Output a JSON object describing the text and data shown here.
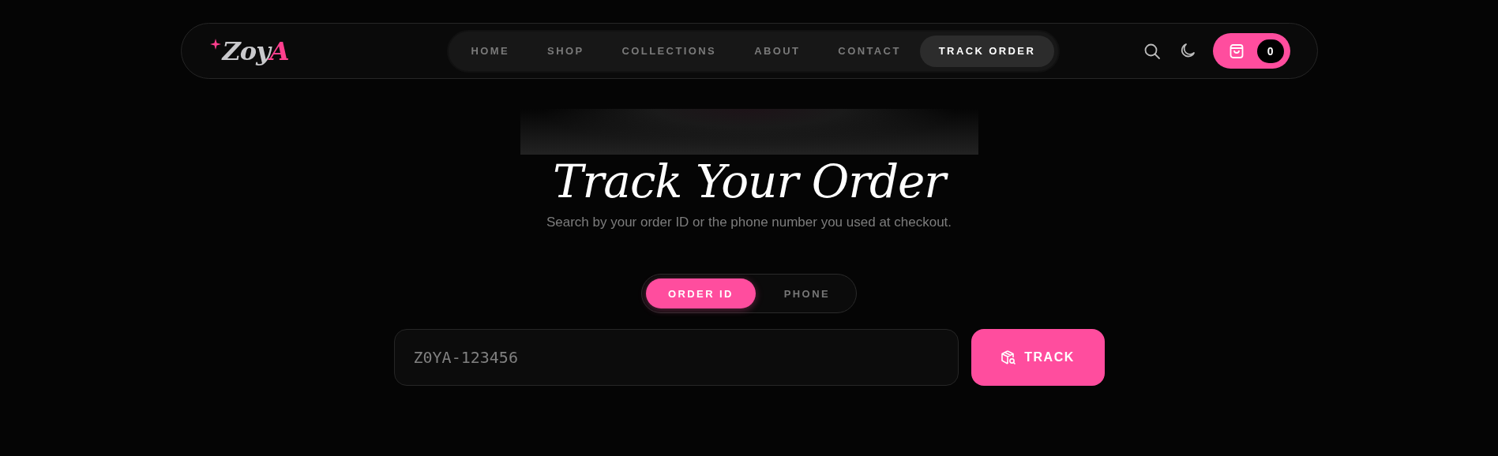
{
  "header": {
    "logo": {
      "text": "Zoy",
      "accent": "A"
    },
    "nav": [
      {
        "label": "HOME",
        "selected": false
      },
      {
        "label": "SHOP",
        "selected": false
      },
      {
        "label": "COLLECTIONS",
        "selected": false
      },
      {
        "label": "ABOUT",
        "selected": false
      },
      {
        "label": "CONTACT",
        "selected": false
      },
      {
        "label": "TRACK ORDER",
        "selected": true
      }
    ],
    "cart_count": "0"
  },
  "hero": {
    "title": "Track Your Order",
    "subtitle": "Search by your order ID or the phone number you used at checkout."
  },
  "form": {
    "modes": [
      {
        "label": "ORDER ID",
        "selected": true
      },
      {
        "label": "PHONE",
        "selected": false
      }
    ],
    "input": {
      "placeholder": "Z0YA-123456"
    },
    "button": "TRACK"
  }
}
